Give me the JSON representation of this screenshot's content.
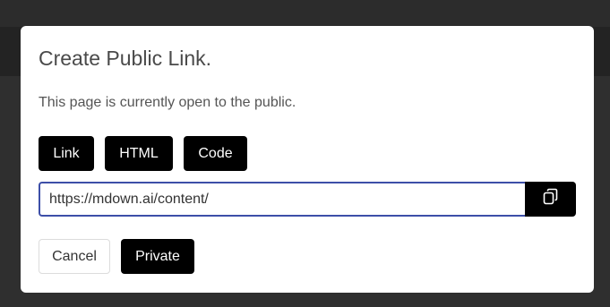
{
  "dialog": {
    "title": "Create Public Link.",
    "description": "This page is currently open to the public.",
    "format_tabs": [
      {
        "label": "Link"
      },
      {
        "label": "HTML"
      },
      {
        "label": "Code"
      }
    ],
    "url_field": {
      "value": "https://mdown.ai/content/"
    },
    "copy_button": {
      "icon": "copy-icon"
    },
    "actions": {
      "cancel_label": "Cancel",
      "private_label": "Private"
    }
  },
  "colors": {
    "backdrop": "#2c2c2c",
    "dialog_bg": "#ffffff",
    "primary_button": "#000000",
    "input_focus_border": "#3d4fa8"
  }
}
